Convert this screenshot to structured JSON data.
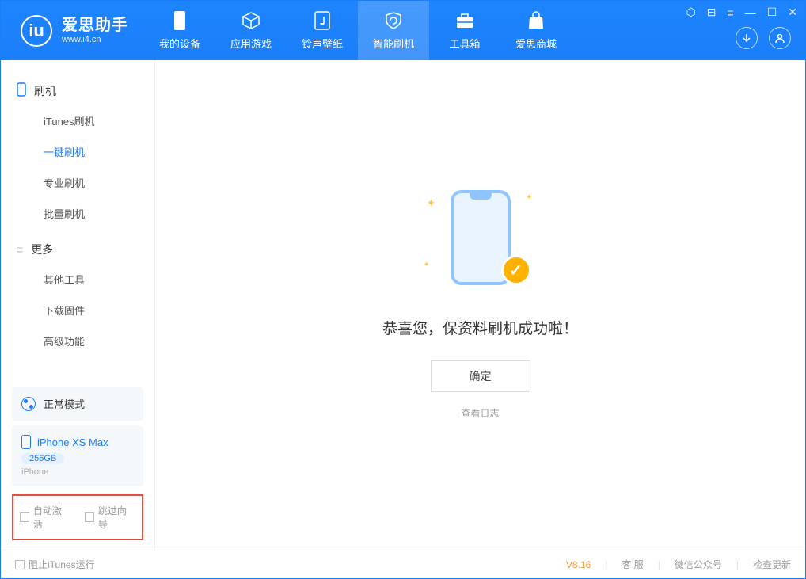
{
  "app": {
    "title": "爱思助手",
    "subtitle": "www.i4.cn"
  },
  "tabs": {
    "device": "我的设备",
    "apps": "应用游戏",
    "ringtones": "铃声壁纸",
    "flash": "智能刷机",
    "toolbox": "工具箱",
    "store": "爱思商城"
  },
  "sidebar": {
    "flash_header": "刷机",
    "items": {
      "itunes": "iTunes刷机",
      "oneclick": "一键刷机",
      "pro": "专业刷机",
      "batch": "批量刷机"
    },
    "more_header": "更多",
    "more": {
      "other": "其他工具",
      "firmware": "下载固件",
      "advanced": "高级功能"
    }
  },
  "mode": {
    "label": "正常模式"
  },
  "device": {
    "name": "iPhone XS Max",
    "storage": "256GB",
    "type": "iPhone"
  },
  "options": {
    "auto_activate": "自动激活",
    "skip_guide": "跳过向导"
  },
  "main": {
    "success": "恭喜您，保资料刷机成功啦！",
    "ok": "确定",
    "view_log": "查看日志"
  },
  "status": {
    "block_itunes": "阻止iTunes运行",
    "version": "V8.16",
    "support": "客 服",
    "wechat": "微信公众号",
    "update": "检查更新"
  }
}
